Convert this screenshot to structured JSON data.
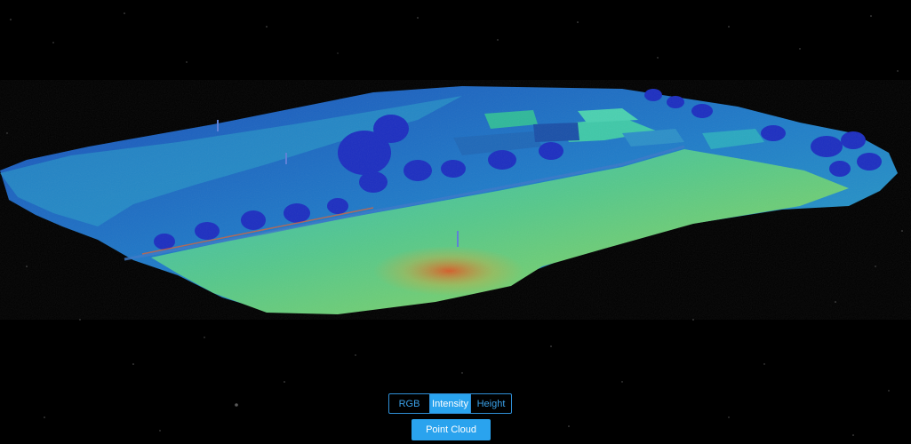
{
  "viewer": {
    "render_mode": "Intensity",
    "background_color": "#000000"
  },
  "controls": {
    "modes": [
      {
        "label": "RGB",
        "active": false
      },
      {
        "label": "Intensity",
        "active": true
      },
      {
        "label": "Height",
        "active": false
      }
    ],
    "view_button_label": "Point Cloud",
    "accent_color": "#2aa3ee"
  }
}
